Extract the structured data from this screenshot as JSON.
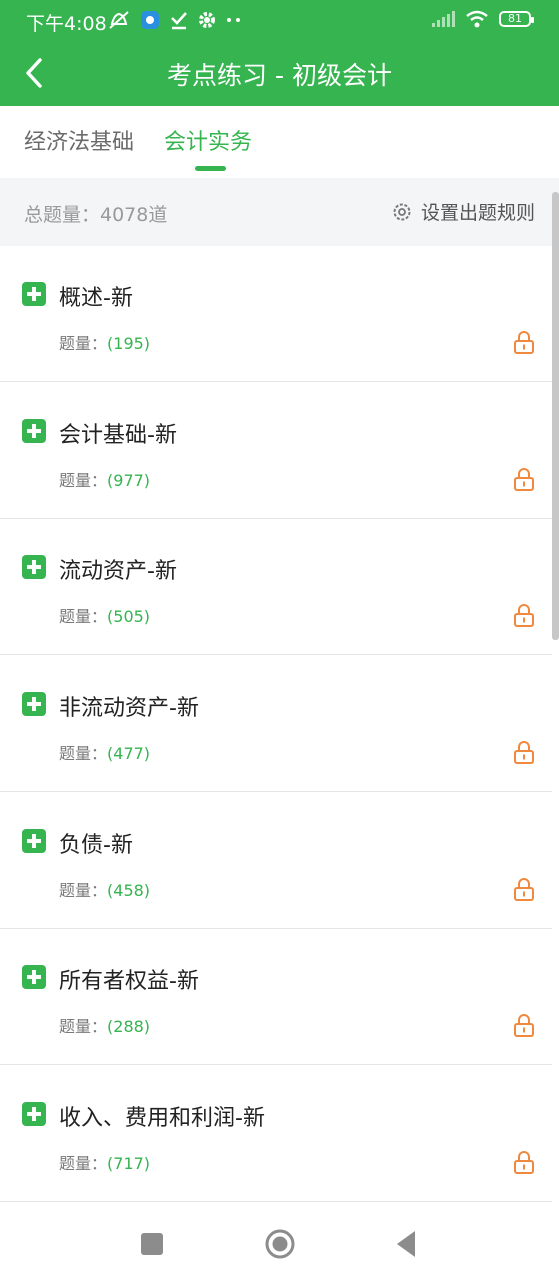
{
  "status_bar": {
    "time": "下午4:08",
    "battery": "81",
    "icons": [
      "mute-icon",
      "app-notification-icon",
      "check-icon",
      "gear-icon",
      "more-dots-icon",
      "signal-icon",
      "wifi-icon",
      "battery-icon"
    ]
  },
  "header": {
    "title": "考点练习 - 初级会计",
    "back_icon": "chevron-left-icon"
  },
  "tabs": [
    {
      "label": "经济法基础",
      "active": false
    },
    {
      "label": "会计实务",
      "active": true
    }
  ],
  "summary": {
    "total_label": "总题量：4078道",
    "rule_label": "设置出题规则",
    "rule_icon": "gear-icon"
  },
  "count_label": "题量：",
  "items": [
    {
      "name": "概述-新",
      "count": "(195)"
    },
    {
      "name": "会计基础-新",
      "count": "(977)"
    },
    {
      "name": "流动资产-新",
      "count": "(505)"
    },
    {
      "name": "非流动资产-新",
      "count": "(477)"
    },
    {
      "name": "负债-新",
      "count": "(458)"
    },
    {
      "name": "所有者权益-新",
      "count": "(288)"
    },
    {
      "name": "收入、费用和利润-新",
      "count": "(717)"
    }
  ],
  "colors": {
    "accent": "#35b44f",
    "lock": "#f0883e",
    "background": "#f3f5f6"
  },
  "nav_bar": {
    "icons": [
      "recent-apps-icon",
      "home-icon",
      "back-triangle-icon"
    ]
  }
}
